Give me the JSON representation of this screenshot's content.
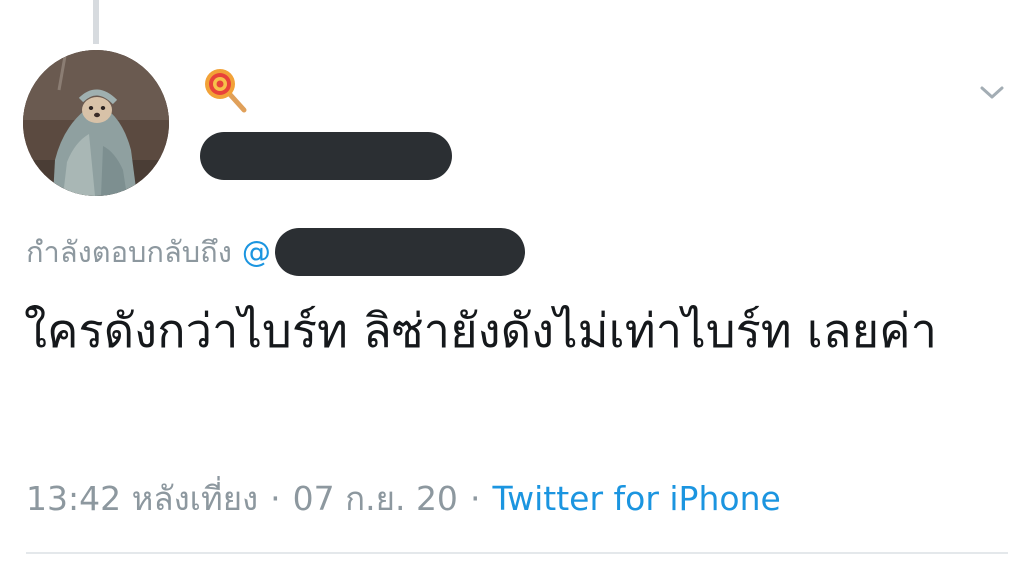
{
  "tweet": {
    "display_name_icon": "lollipop-emoji",
    "reply_prefix": "กำลังตอบกลับถึง",
    "reply_at": "@",
    "text": "ใครดังกว่าไบร์ท ลิซ่ายังดังไม่เท่าไบร์ท เลยค่า",
    "time": "13:42 หลังเที่ยง",
    "separator": "·",
    "date": "07 ก.ย. 20",
    "source": "Twitter for iPhone"
  },
  "colors": {
    "link": "#1b95e0",
    "muted": "#8d989f",
    "text": "#15181b",
    "redaction": "#2b2f33"
  },
  "icons": {
    "menu": "chevron-down-icon",
    "avatar": "avatar-photo"
  }
}
